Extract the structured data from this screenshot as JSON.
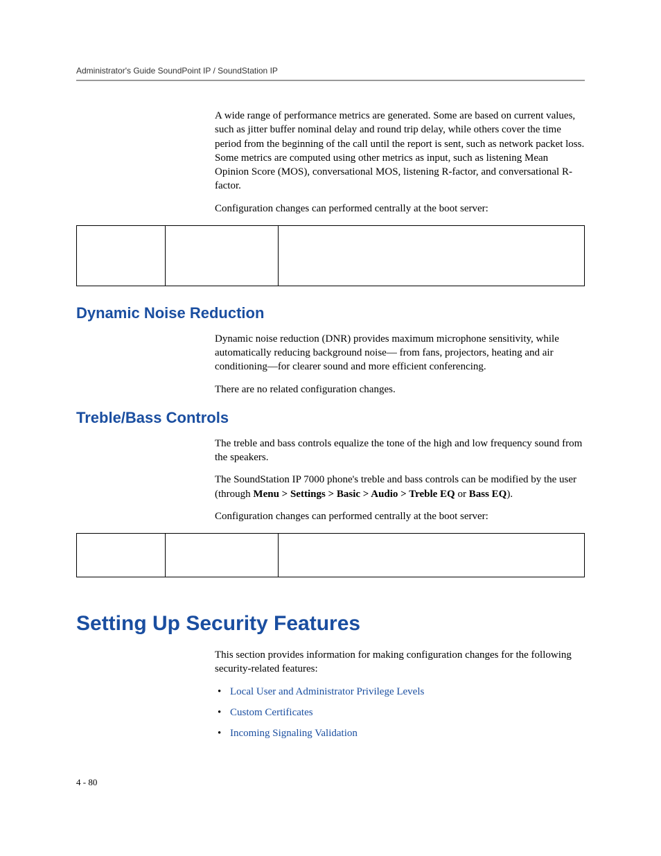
{
  "header": {
    "running_title": "Administrator's Guide SoundPoint IP / SoundStation IP"
  },
  "intro": {
    "p1": "A wide range of performance metrics are generated. Some are based on current values, such as jitter buffer nominal delay and round trip delay, while others cover the time period from the beginning of the call until the report is sent, such as network packet loss. Some metrics are computed using other metrics as input, such as listening Mean Opinion Score (MOS), conversational MOS, listening R-factor, and conversational R-factor.",
    "p2": "Configuration changes can performed centrally at the boot server:"
  },
  "dnr": {
    "heading": "Dynamic Noise Reduction",
    "p1": "Dynamic noise reduction (DNR) provides maximum microphone sensitivity, while automatically reducing background noise—  from fans, projectors, heating and air conditioning—for clearer sound and more efficient conferencing.",
    "p2": "There are no related configuration changes."
  },
  "treble": {
    "heading": "Treble/Bass Controls",
    "p1": "The treble and bass controls equalize the tone of the high and low frequency sound from the speakers.",
    "p2_pre": "The SoundStation IP 7000 phone's treble and bass controls can be modified by the user (through ",
    "p2_bold": "Menu > Settings > Basic > Audio > Treble EQ",
    "p2_mid": " or ",
    "p2_bold2": "Bass EQ",
    "p2_post": ").",
    "p3": "Configuration changes can performed centrally at the boot server:"
  },
  "security": {
    "heading": "Setting Up Security Features",
    "intro": "This section provides information for making configuration changes for the following security-related features:",
    "links": [
      "Local User and Administrator Privilege Levels",
      "Custom Certificates",
      "Incoming Signaling Validation"
    ]
  },
  "footer": {
    "page_number": "4 - 80"
  }
}
